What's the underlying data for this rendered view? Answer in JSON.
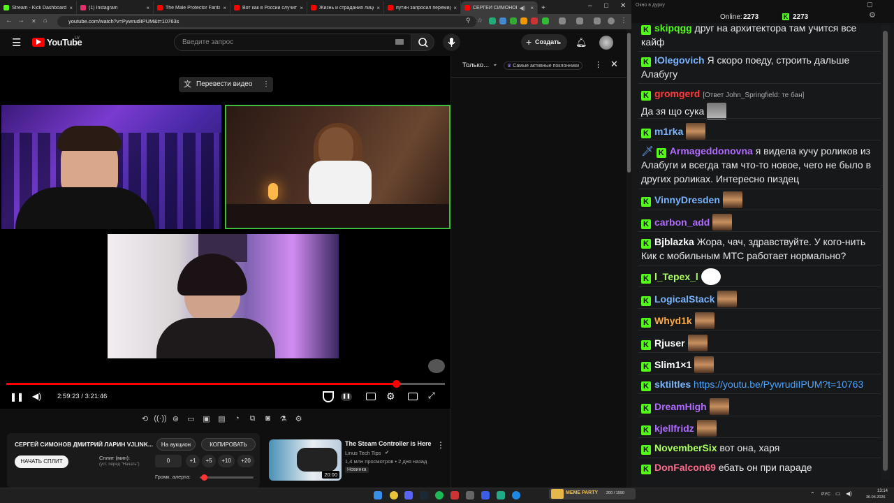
{
  "browser": {
    "tabs": [
      {
        "label": "Stream - Kick Dashboard",
        "color": "#53fc18"
      },
      {
        "label": "(1) Instagram",
        "color": "#e1306c"
      },
      {
        "label": "The Male Protector Fantasy",
        "color": "#ff0000"
      },
      {
        "label": "Вот как в России случится",
        "color": "#ff0000"
      },
      {
        "label": "Жизнь и страдания лицемер",
        "color": "#ff0000"
      },
      {
        "label": "путин запросил перемирие",
        "color": "#ff0000"
      },
      {
        "label": "СЕРГЕЙ СИМОНОВ ДМ",
        "color": "#ff0000"
      }
    ],
    "new_tab": "+",
    "url": "youtube.com/watch?v=PywrudiIPUM&t=10763s"
  },
  "youtube": {
    "logo": "YouTube",
    "logo_region": "LV",
    "search_placeholder": "Введите запрос",
    "create_label": "Создать",
    "translate_label": "Перевести видео",
    "time_current": "2:59:23",
    "time_total": "3:21:46",
    "time_display": "2:59:23 / 3:21:46",
    "progress_fraction": 0.889,
    "chat_filter": "Только...",
    "chat_top_fans": "Самые активные поклонники",
    "stream_title": "СЕРГЕЙ СИМОНОВ ДМИТРИЙ ЛАРИН VJLINK...",
    "auction_label": "На аукцион",
    "copy_label": "КОПИРОВАТЬ",
    "start_split": "НАЧАТЬ СПЛИТ",
    "split_label": "Сплит (мин):",
    "split_hint": "(уст. перед \"Начать\")",
    "split_value": "0",
    "split_buttons": [
      "+1",
      "+5",
      "+10",
      "+20"
    ],
    "volume_alert_label": "Громк. алерта:",
    "recommended": {
      "title": "The Steam Controller is Here",
      "channel": "Linus Tech Tips",
      "meta": "1,4 млн просмотров • 2 дня назад",
      "badge": "Новинка",
      "duration": "20:00"
    }
  },
  "kick": {
    "window_title": "Окно в дурку",
    "online_label": "Online:",
    "online_count": "2273",
    "followers_count": "2273",
    "messages": [
      {
        "user": "skipqgg",
        "color": "#53fc18",
        "text": "друг на архитектора там учится все кайф"
      },
      {
        "user": "lOlegovich",
        "color": "#7ab4ff",
        "text": "Я скоро поеду, строить дальше Алабугу"
      },
      {
        "user": "gromgerd",
        "color": "#ff3b3b",
        "reply": "[Ответ John_Springfield: те бан]",
        "text": "Да зя що сука"
      },
      {
        "user": "m1rka",
        "color": "#7ab4ff",
        "text": ""
      },
      {
        "user": "Armageddonovna",
        "color": "#b06bff",
        "text": "я видела кучу роликов из Алабуги и всегда там что-то новое, чего не было в других роликах. Интересно пиздец"
      },
      {
        "user": "VinnyDresden",
        "color": "#7ab4ff",
        "text": ""
      },
      {
        "user": "carbon_add",
        "color": "#b06bff",
        "text": ""
      },
      {
        "user": "Bjblazka",
        "color": "#ffffff",
        "text": "Жора, чач, здравствуйте. У кого-нить Кик с мобильным МТС работает нормально?"
      },
      {
        "user": "l_Tepex_l",
        "color": "#aaff5a",
        "text": ""
      },
      {
        "user": "LogicalStack",
        "color": "#7ab4ff",
        "text": ""
      },
      {
        "user": "Whyd1k",
        "color": "#ffaa3b",
        "text": ""
      },
      {
        "user": "Rjuser",
        "color": "#ffffff",
        "text": ""
      },
      {
        "user": "Slim1×1",
        "color": "#ffffff",
        "text": ""
      },
      {
        "user": "sktiltles",
        "color": "#7ab4ff",
        "text": "https://youtu.be/PywrudiIPUM?t=10763"
      },
      {
        "user": "DreamHigh",
        "color": "#b06bff",
        "text": ""
      },
      {
        "user": "kjellfridz",
        "color": "#b06bff",
        "text": ""
      },
      {
        "user": "NovemberSix",
        "color": "#aaff5a",
        "text": "вот она, харя"
      },
      {
        "user": "DonFalcon69",
        "color": "#ff6b8b",
        "text": "ебать он при параде"
      }
    ]
  },
  "taskbar": {
    "overlay_label": "MEME PARTY",
    "overlay_counter": "200 / 1590",
    "lang": "РУС",
    "time": "13:14",
    "date": "30.04.2026"
  }
}
